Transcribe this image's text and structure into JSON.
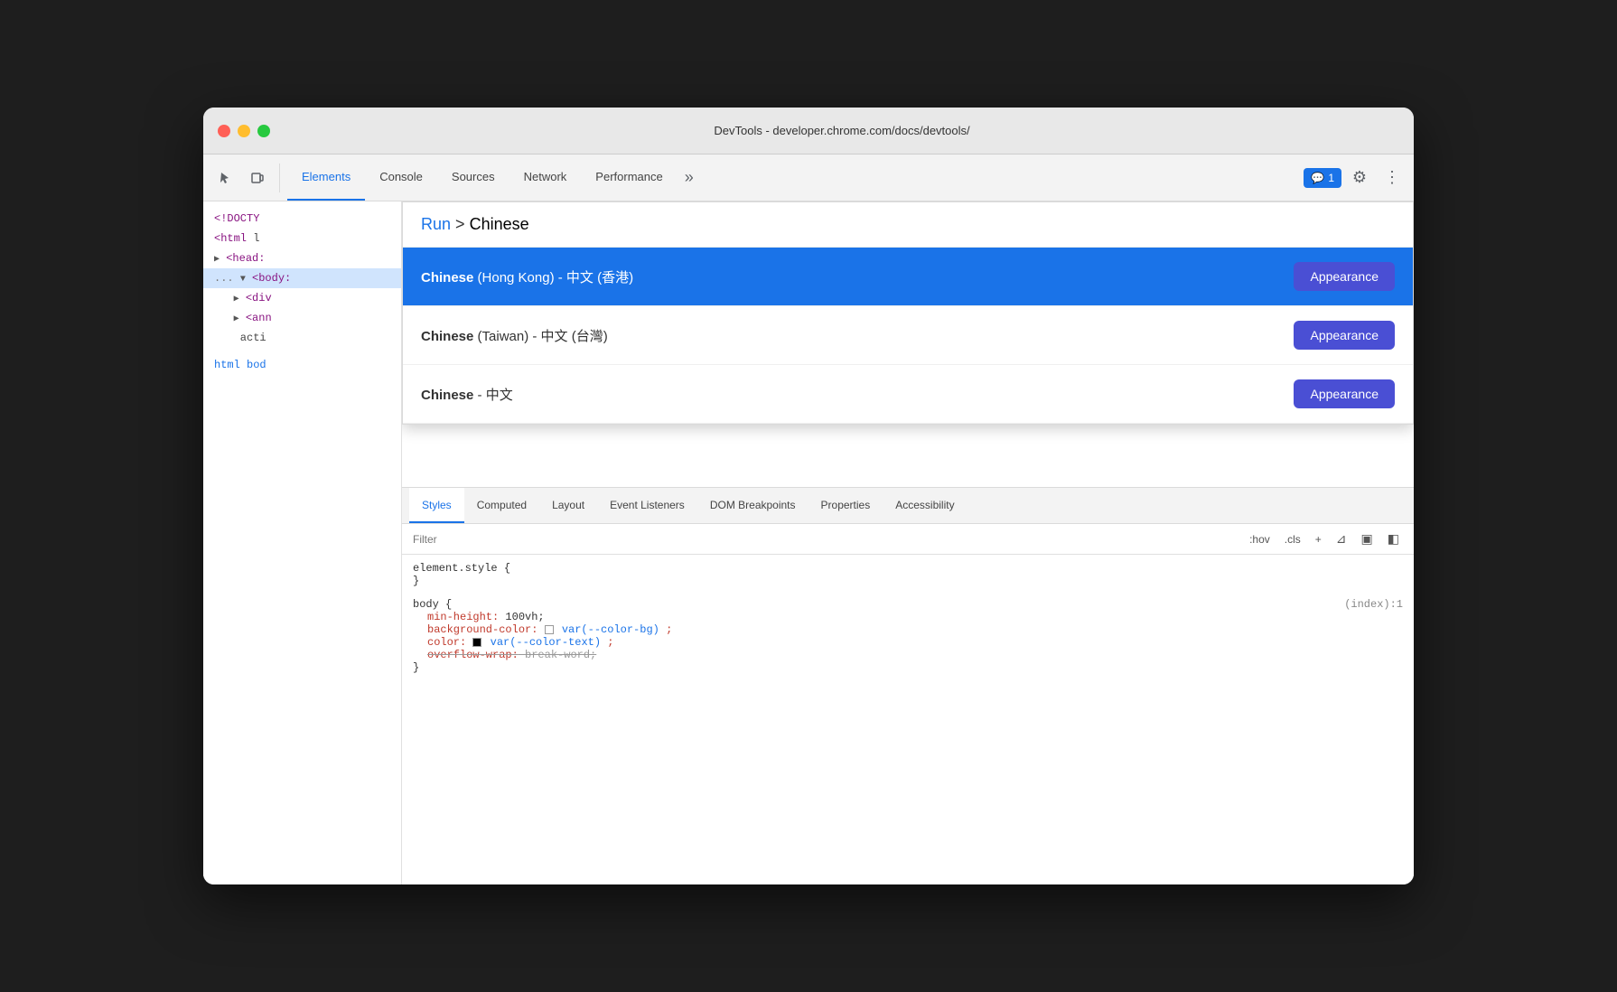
{
  "window": {
    "title": "DevTools - developer.chrome.com/docs/devtools/"
  },
  "toolbar": {
    "tabs": [
      {
        "id": "elements",
        "label": "Elements",
        "active": true
      },
      {
        "id": "console",
        "label": "Console",
        "active": false
      },
      {
        "id": "sources",
        "label": "Sources",
        "active": false
      },
      {
        "id": "network",
        "label": "Network",
        "active": false
      },
      {
        "id": "performance",
        "label": "Performance",
        "active": false
      }
    ],
    "more_label": "»",
    "badge_label": "1",
    "settings_icon": "⚙",
    "more_icon": "⋮"
  },
  "command_dropdown": {
    "run_label": "Run",
    "query": ">Chinese",
    "items": [
      {
        "id": "hong-kong",
        "name_bold": "Chinese",
        "name_rest": " (Hong Kong) - 中文 (香港)",
        "button_label": "Appearance",
        "highlighted": true
      },
      {
        "id": "taiwan",
        "name_bold": "Chinese",
        "name_rest": " (Taiwan) - 中文 (台灣)",
        "button_label": "Appearance",
        "highlighted": false
      },
      {
        "id": "chinese",
        "name_bold": "Chinese",
        "name_rest": " - 中文",
        "button_label": "Appearance",
        "highlighted": false
      }
    ]
  },
  "dom_panel": {
    "lines": [
      {
        "text": "<!DOCTY",
        "type": "tag"
      },
      {
        "text": "<html l",
        "type": "tag"
      },
      {
        "text": "▶ <head:",
        "type": "tag"
      },
      {
        "text": "... ▼ <body:",
        "type": "tag"
      },
      {
        "text": "  ▶ <div",
        "type": "tag"
      },
      {
        "text": "  ▶ <ann",
        "type": "tag"
      },
      {
        "text": "    acti",
        "type": "text"
      }
    ]
  },
  "breadcrumb": {
    "items": [
      "html",
      "bod"
    ]
  },
  "subtabs": {
    "items": [
      {
        "id": "styles",
        "label": "Styles",
        "active": true
      },
      {
        "id": "computed",
        "label": "Computed",
        "active": false
      },
      {
        "id": "layout",
        "label": "Layout",
        "active": false
      },
      {
        "id": "event-listeners",
        "label": "Event Listeners",
        "active": false
      },
      {
        "id": "dom-breakpoints",
        "label": "DOM Breakpoints",
        "active": false
      },
      {
        "id": "properties",
        "label": "Properties",
        "active": false
      },
      {
        "id": "accessibility",
        "label": "Accessibility",
        "active": false
      }
    ]
  },
  "filter": {
    "placeholder": "Filter",
    "hov_label": ":hov",
    "cls_label": ".cls",
    "plus_label": "+",
    "icons": [
      "adjust-icon",
      "sidebar-icon",
      "layout-icon"
    ]
  },
  "css_rules": [
    {
      "selector": "element.style {",
      "close": "}",
      "properties": []
    },
    {
      "selector": "body {",
      "close": "}",
      "link": "(index):1",
      "properties": [
        {
          "prop": "min-height:",
          "value": "100vh;"
        },
        {
          "prop": "background-color:",
          "value": "var(--color-bg);",
          "has_swatch": true,
          "swatch_color": "white"
        },
        {
          "prop": "color:",
          "value": "var(--color-text);",
          "has_swatch": true,
          "swatch_color": "black"
        },
        {
          "prop": "overflow-wrap:",
          "value": "break-word;",
          "strikethrough": true
        }
      ]
    }
  ],
  "colors": {
    "accent_blue": "#1a73e8",
    "appearance_btn": "#4a4fd4",
    "highlight_row": "#1a73e8"
  }
}
